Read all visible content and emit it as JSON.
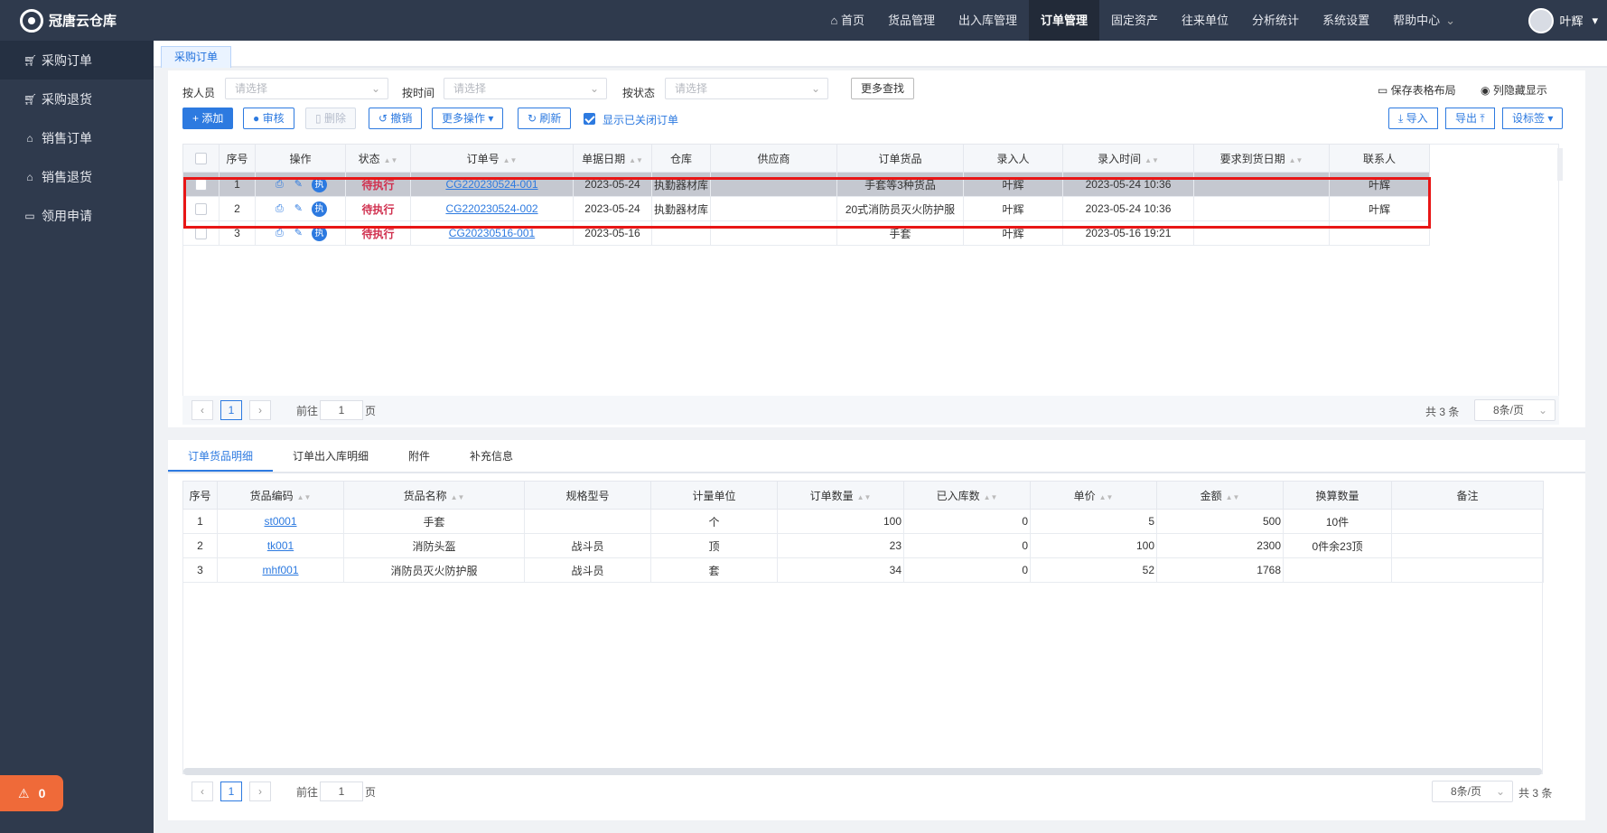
{
  "app": {
    "title": "冠唐云仓库"
  },
  "sidebar": {
    "items": [
      {
        "label": "采购订单",
        "icon": "cart-icon"
      },
      {
        "label": "采购退货",
        "icon": "cart-icon"
      },
      {
        "label": "销售订单",
        "icon": "bag-icon"
      },
      {
        "label": "销售退货",
        "icon": "bag-icon"
      },
      {
        "label": "领用申请",
        "icon": "box-icon"
      }
    ]
  },
  "alarm": {
    "count": "0"
  },
  "nav": {
    "items": [
      "首页",
      "货品管理",
      "出入库管理",
      "订单管理",
      "固定资产",
      "往来单位",
      "分析统计",
      "系统设置",
      "帮助中心"
    ],
    "active": "订单管理"
  },
  "user": {
    "name": "叶辉"
  },
  "page_tab": "采购订单",
  "filters": {
    "operator_label": "按人员",
    "operator_placeholder": "请选择",
    "time_label": "按时间",
    "time_placeholder": "请选择",
    "status_label": "按状态",
    "status_placeholder": "请选择",
    "more_search": "更多查找",
    "save_layout": "保存表格布局",
    "column_toggle": "列隐藏显示"
  },
  "toolbar": {
    "add": "添加",
    "audit": "审核",
    "delete": "删除",
    "cancel": "撤销",
    "more_ops": "更多操作",
    "refresh": "刷新",
    "show_closed": "显示已关闭订单",
    "import": "导入",
    "export": "导出",
    "settings": "设标签"
  },
  "orders": {
    "headers": [
      "序号",
      "操作",
      "状态",
      "订单号",
      "单据日期",
      "仓库",
      "供应商",
      "订单货品",
      "录入人",
      "录入时间",
      "要求到货日期",
      "联系人"
    ],
    "rows": [
      {
        "idx": "1",
        "status": "待执行",
        "order_no": "CG220230524-001",
        "date": "2023-05-24",
        "warehouse": "执勤器材库",
        "supplier": "",
        "goods": "手套等3种货品",
        "entry": "叶辉",
        "entry_time": "2023-05-24 10:36",
        "req_date": "",
        "contact": "叶辉"
      },
      {
        "idx": "2",
        "status": "待执行",
        "order_no": "CG220230524-002",
        "date": "2023-05-24",
        "warehouse": "执勤器材库",
        "supplier": "",
        "goods": "20式消防员灭火防护服",
        "entry": "叶辉",
        "entry_time": "2023-05-24 10:36",
        "req_date": "",
        "contact": "叶辉"
      },
      {
        "idx": "3",
        "status": "待执行",
        "order_no": "CG20230516-001",
        "date": "2023-05-16",
        "warehouse": "",
        "supplier": "",
        "goods": "手套",
        "entry": "叶辉",
        "entry_time": "2023-05-16 19:21",
        "req_date": "",
        "contact": ""
      }
    ],
    "op_exec": "执"
  },
  "pager_top": {
    "current": "1",
    "goto_prefix": "前往",
    "goto_value": "1",
    "goto_suffix": "页",
    "total": "共 3 条",
    "page_size": "8条/页"
  },
  "subtabs": [
    "订单货品明细",
    "订单出入库明细",
    "附件",
    "补充信息"
  ],
  "details": {
    "headers": [
      "序号",
      "货品编码",
      "货品名称",
      "规格型号",
      "计量单位",
      "订单数量",
      "已入库数",
      "单价",
      "金额",
      "换算数量",
      "备注"
    ],
    "rows": [
      {
        "idx": "1",
        "code": "st0001",
        "name": "手套",
        "spec": "",
        "unit": "个",
        "qty": "100",
        "in": "0",
        "price": "5",
        "amount": "500",
        "conv": "10件",
        "note": ""
      },
      {
        "idx": "2",
        "code": "tk001",
        "name": "消防头盔",
        "spec": "战斗员",
        "unit": "顶",
        "qty": "23",
        "in": "0",
        "price": "100",
        "amount": "2300",
        "conv": "0件余23顶",
        "note": ""
      },
      {
        "idx": "3",
        "code": "mhf001",
        "name": "消防员灭火防护服",
        "spec": "战斗员",
        "unit": "套",
        "qty": "34",
        "in": "0",
        "price": "52",
        "amount": "1768",
        "conv": "",
        "note": ""
      }
    ]
  },
  "pager_bottom": {
    "current": "1",
    "goto_prefix": "前往",
    "goto_value": "1",
    "goto_suffix": "页",
    "page_size": "8条/页",
    "total": "共 3 条"
  }
}
